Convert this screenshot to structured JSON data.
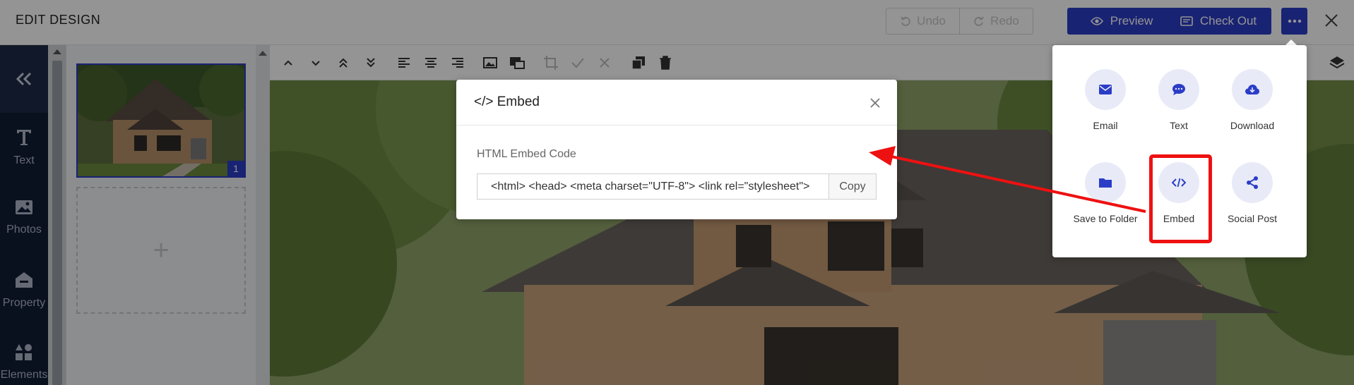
{
  "header": {
    "title": "EDIT DESIGN",
    "undo_label": "Undo",
    "redo_label": "Redo",
    "preview_label": "Preview",
    "checkout_label": "Check Out"
  },
  "sidebar": {
    "items": [
      {
        "label": "Text",
        "icon": "text-icon"
      },
      {
        "label": "Photos",
        "icon": "photos-icon"
      },
      {
        "label": "Property",
        "icon": "property-icon"
      },
      {
        "label": "Elements",
        "icon": "elements-icon"
      }
    ]
  },
  "pages": {
    "items": [
      {
        "number": "1"
      }
    ],
    "add_label": "+"
  },
  "modal": {
    "title": "</> Embed",
    "field_label": "HTML Embed Code",
    "embed_code": "<html> <head> <meta charset=\"UTF-8\"> <link rel=\"stylesheet\">",
    "copy_label": "Copy"
  },
  "share_menu": {
    "items": [
      {
        "label": "Email",
        "icon": "email-icon"
      },
      {
        "label": "Text",
        "icon": "chat-icon"
      },
      {
        "label": "Download",
        "icon": "cloud-download-icon"
      },
      {
        "label": "Save to Folder",
        "icon": "folder-icon"
      },
      {
        "label": "Embed",
        "icon": "code-icon"
      },
      {
        "label": "Social Post",
        "icon": "share-icon"
      }
    ]
  },
  "colors": {
    "accent": "#2b3dc7",
    "rail": "#111d35",
    "annotation": "#ee1111",
    "menu_circle": "#e8ebf7"
  }
}
